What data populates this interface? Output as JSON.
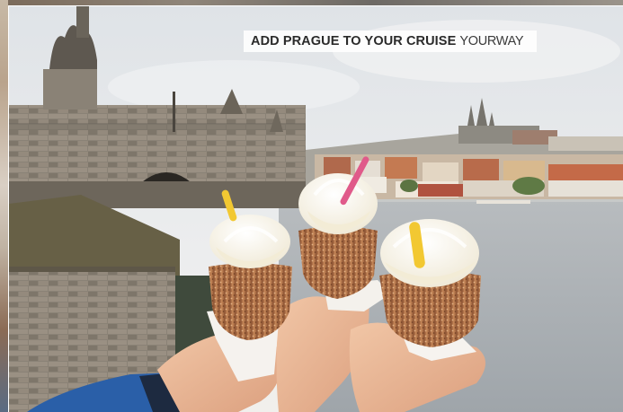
{
  "headline": {
    "main": "ADD PRAGUE TO YOUR CRUISE",
    "accent": "YOURWAY"
  },
  "colors": {
    "sky": "#e8ebee",
    "river": "#a4aab0",
    "stone": "#7f776c",
    "pastry": "#b87a4e",
    "cream": "#fbf6e8",
    "straw_yellow": "#f2c832",
    "straw_pink": "#e05a8a",
    "jacket_blue": "#2a5fa8"
  },
  "icons": {
    "photo": "photo-of-trdelnik-cones-over-charles-bridge"
  }
}
